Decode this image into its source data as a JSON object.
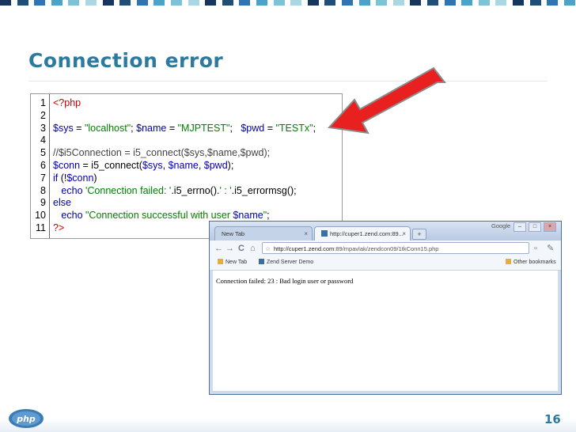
{
  "slide": {
    "title": "Connection error",
    "page_number": "16",
    "logo_text": "php"
  },
  "colors": {
    "title": "#2d7aa0",
    "arrow": "#e82020",
    "top_squares": [
      "#17365d",
      "#1f4e79",
      "#2e75b6",
      "#4aa3c8",
      "#7dc3d8",
      "#a9d8e4"
    ]
  },
  "code": {
    "lines": [
      {
        "n": "1",
        "parts": [
          {
            "t": "<?php",
            "c": "r"
          }
        ]
      },
      {
        "n": "2",
        "parts": []
      },
      {
        "n": "3",
        "parts": [
          {
            "t": "$sys",
            "c": "k"
          },
          {
            "t": " = ",
            "c": "v"
          },
          {
            "t": "\"localhost\"",
            "c": "s"
          },
          {
            "t": "; ",
            "c": "v"
          },
          {
            "t": "$name",
            "c": "k"
          },
          {
            "t": " = ",
            "c": "v"
          },
          {
            "t": "\"MJPTEST\"",
            "c": "s"
          },
          {
            "t": ";   ",
            "c": "v"
          },
          {
            "t": "$pwd",
            "c": "k"
          },
          {
            "t": " = ",
            "c": "v"
          },
          {
            "t": "\"TESTx\"",
            "c": "s"
          },
          {
            "t": ";",
            "c": "v"
          }
        ]
      },
      {
        "n": "4",
        "parts": []
      },
      {
        "n": "5",
        "parts": [
          {
            "t": "//$i5Connection = i5_connect($sys,$name,$pwd);",
            "c": "c"
          }
        ]
      },
      {
        "n": "6",
        "parts": [
          {
            "t": "$conn",
            "c": "k"
          },
          {
            "t": " = i5_connect(",
            "c": "v"
          },
          {
            "t": "$sys",
            "c": "k"
          },
          {
            "t": ", ",
            "c": "v"
          },
          {
            "t": "$name",
            "c": "k"
          },
          {
            "t": ", ",
            "c": "v"
          },
          {
            "t": "$pwd",
            "c": "k"
          },
          {
            "t": ");",
            "c": "v"
          }
        ]
      },
      {
        "n": "7",
        "parts": [
          {
            "t": "if",
            "c": "k"
          },
          {
            "t": " (!",
            "c": "v"
          },
          {
            "t": "$conn",
            "c": "k"
          },
          {
            "t": ")",
            "c": "v"
          }
        ]
      },
      {
        "n": "8",
        "parts": [
          {
            "t": "   echo ",
            "c": "k"
          },
          {
            "t": "'Connection failed: '",
            "c": "s"
          },
          {
            "t": ".i5_errno().",
            "c": "v"
          },
          {
            "t": "' : '",
            "c": "s"
          },
          {
            "t": ".i5_errormsg();",
            "c": "v"
          }
        ]
      },
      {
        "n": "9",
        "parts": [
          {
            "t": "else",
            "c": "k"
          }
        ]
      },
      {
        "n": "10",
        "parts": [
          {
            "t": "   echo ",
            "c": "k"
          },
          {
            "t": "\"Connection successful with user ",
            "c": "s"
          },
          {
            "t": "$name",
            "c": "k"
          },
          {
            "t": "\"",
            "c": "s"
          },
          {
            "t": ";",
            "c": "v"
          }
        ]
      },
      {
        "n": "11",
        "parts": [
          {
            "t": "?>",
            "c": "r"
          }
        ]
      }
    ]
  },
  "browser": {
    "tab_newtab": "New Tab",
    "tab_active": "http://cuper1.zend.com:89...",
    "tab_close": "×",
    "new_tab_button": "+",
    "brand": "Google",
    "window_buttons": [
      "–",
      "□",
      "×"
    ],
    "nav": {
      "back": "←",
      "forward": "→",
      "reload": "C",
      "home": "⌂",
      "page_menu": "▫",
      "tools_menu": "✎"
    },
    "address": {
      "host": "http://cuper1.zend.com",
      "path": ":89/mpavlak/zendcon09/1tkConn15.php"
    },
    "bookmarks": {
      "new_tab": "New Tab",
      "zend": "Zend Server Demo",
      "other": "Other bookmarks"
    },
    "page_message": "Connection failed: 23 : Bad login user or password"
  }
}
